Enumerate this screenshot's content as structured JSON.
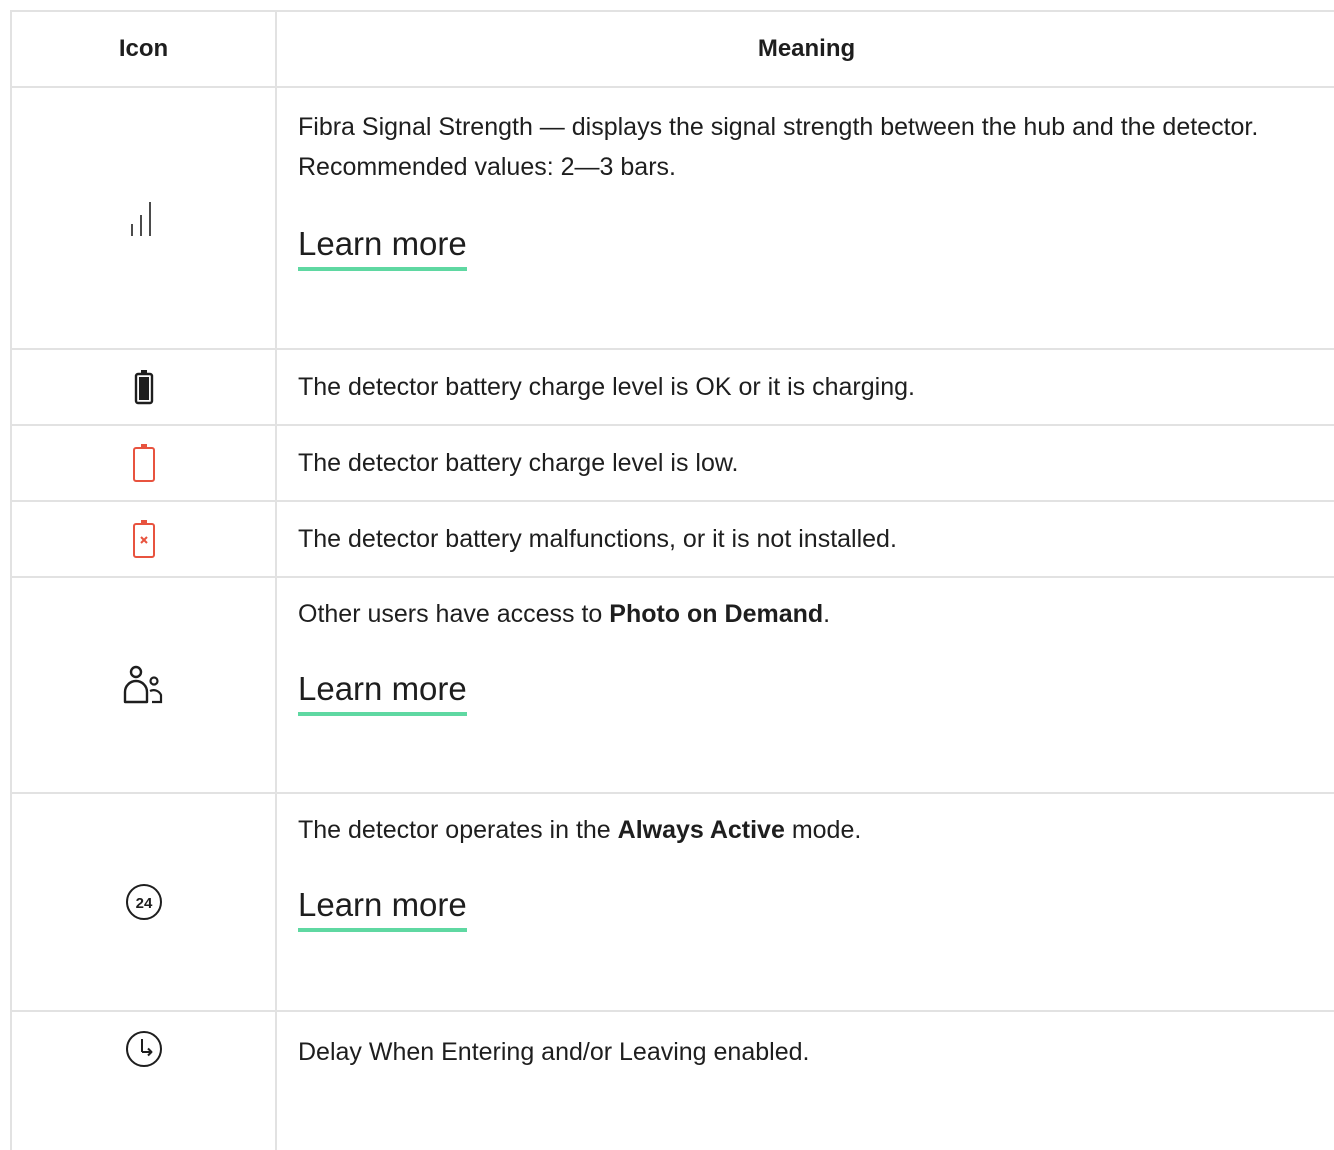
{
  "header": {
    "icon_col": "Icon",
    "meaning_col": "Meaning"
  },
  "rows": [
    {
      "icon": "signal-strength-icon",
      "text": "Fibra Signal Strength — displays the signal strength between the hub and the detector. Recommended values: 2—3 bars.",
      "link": "Learn more"
    },
    {
      "icon": "battery-ok-icon",
      "text": "The detector battery charge level is OK or it is charging."
    },
    {
      "icon": "battery-low-icon",
      "text": "The detector battery charge level is low."
    },
    {
      "icon": "battery-malfunction-icon",
      "text": "The detector battery malfunctions, or it is not installed."
    },
    {
      "icon": "users-access-icon",
      "text_before": "Other users have access to ",
      "text_bold": "Photo on Demand",
      "text_after": ".",
      "link": "Learn more"
    },
    {
      "icon": "always-active-24-icon",
      "icon_label": "24",
      "text_before": "The detector operates in the ",
      "text_bold": "Always Active",
      "text_after": " mode.",
      "link": "Learn more"
    },
    {
      "icon": "delay-clock-icon",
      "text": "Delay When Entering and/or Leaving enabled."
    }
  ],
  "colors": {
    "accent_underline": "#5fd8a2",
    "alert_red": "#e8533f",
    "border": "#e2e2e2",
    "text": "#1e1e1e"
  }
}
